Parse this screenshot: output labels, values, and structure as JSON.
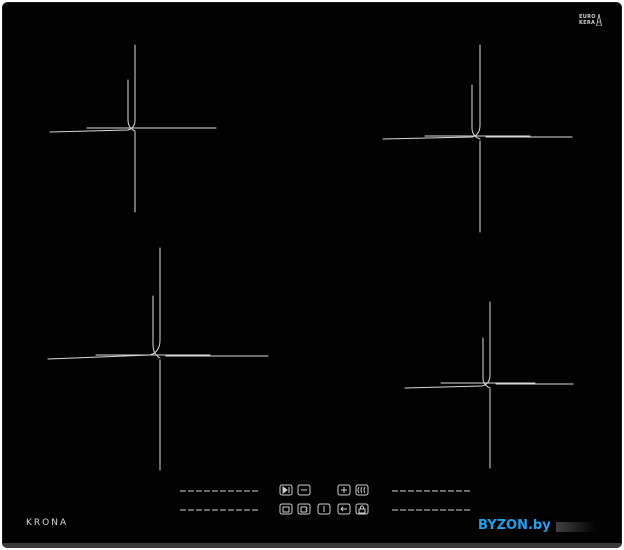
{
  "product": {
    "brand": "KRONA",
    "cert_logo": [
      "EURO",
      "KERA"
    ],
    "watermark": "BYZON.by"
  },
  "control_panel": {
    "left_column": [
      "▶‖",
      "B",
      "⧖"
    ],
    "right_column": [
      "+",
      "((",
      "⟵"
    ],
    "center_symbols": [
      "B",
      "I"
    ]
  },
  "colors": {
    "glass": "#020202",
    "markings": "#d9d9d9",
    "watermark": "#1aa3f0"
  }
}
